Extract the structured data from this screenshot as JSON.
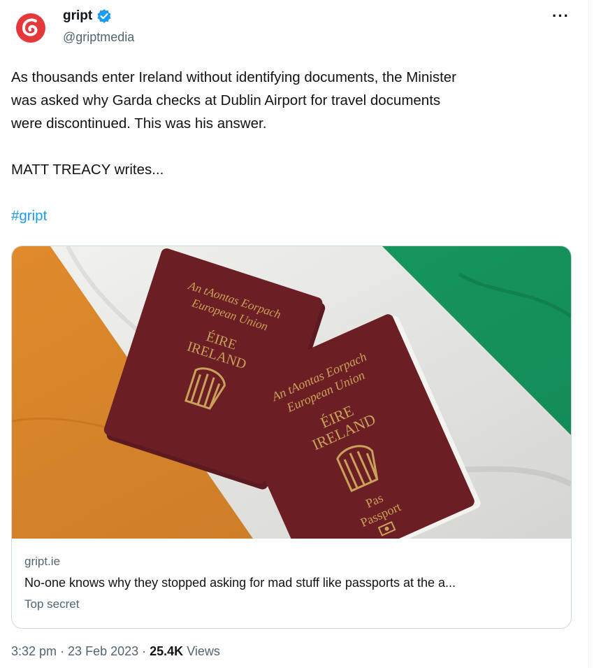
{
  "tweet": {
    "author": {
      "display_name": "gript",
      "handle": "@griptmedia",
      "verified": true,
      "avatar_icon": "gript-logo",
      "brand_color": "#e5383b"
    },
    "more_label": "···",
    "text_lines": [
      "As thousands enter Ireland without identifying documents, the Minister",
      "was asked why Garda checks at Dublin Airport for travel documents",
      "were discontinued. This was his answer."
    ],
    "byline": "MATT TREACY writes...",
    "hashtag": "#gript",
    "card": {
      "domain": "gript.ie",
      "title": "No-one knows why they stopped asking for mad stuff like passports at the a...",
      "description": "Top secret",
      "image": {
        "passport_back": {
          "line1": "An tAontas Eorpach",
          "line2": "European Union",
          "country1": "ÉIRE",
          "country2": "IRELAND"
        },
        "passport_front": {
          "line1": "An tAontas Eorpach",
          "line2": "European Union",
          "country1": "ÉIRE",
          "country2": "IRELAND",
          "type1": "Pas",
          "type2": "Passport"
        },
        "flag_colors": {
          "green": "#169b62",
          "white": "#f4f4f2",
          "orange": "#e08a2c"
        },
        "cover_color": "#6b1f25",
        "gold_color": "#c9a25a"
      }
    },
    "footer": {
      "time": "3:32 pm",
      "sep1": " · ",
      "date": "23 Feb 2023",
      "sep2": " · ",
      "views_count": "25.4K",
      "views_label": " Views"
    },
    "accent": "#1d9bf0"
  }
}
